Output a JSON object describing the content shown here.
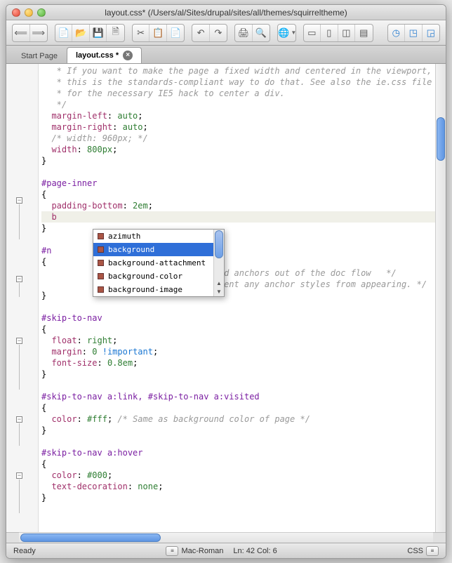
{
  "window": {
    "title": "layout.css* (/Users/al/Sites/drupal/sites/all/themes/squirreltheme)"
  },
  "tabs": {
    "start": "Start Page",
    "active": "layout.css  *"
  },
  "code": {
    "c1": "   * If you want to make the page a fixed width and centered in the viewport,",
    "c2": "   * this is the standards-compliant way to do that. See also the ie.css file",
    "c3": "   * for the necessary IE5 hack to center a div.",
    "c4": "   */",
    "p_ml": "  margin-left",
    "v_auto": "auto",
    "p_mr": "  margin-right",
    "c5": "  /* width: 960px; */",
    "p_w": "  width",
    "v_800": "800px",
    "brace_close": "}",
    "brace_open": "{",
    "sel_pi": "#page-inner",
    "p_pb": "  padding-bottom",
    "v_2em": "2em",
    "cur_b": "  b",
    "sel_n1": "#n",
    "c_named": "/*  the named anchors out of the doc flow   */",
    "c_prevent": "/*  and prevent any anchor styles from appearing. */",
    "sel_stn": "#skip-to-nav",
    "p_fl": "  float",
    "v_right": "right",
    "p_mg": "  margin",
    "v_0": "0",
    "v_imp": "!important",
    "p_fs": "  font-size",
    "v_08em": "0.8em",
    "sel_stn_link": "#skip-to-nav a:link, #skip-to-nav a:visited",
    "p_col": "  color",
    "v_fff": "#fff",
    "c_same": "/* Same as background color of page */",
    "sel_stn_hover": "#skip-to-nav a:hover",
    "v_000": "#000",
    "p_td": "  text-decoration",
    "v_none": "none"
  },
  "autocomplete": {
    "items": [
      "azimuth",
      "background",
      "background-attachment",
      "background-color",
      "background-image"
    ],
    "selected_index": 1
  },
  "status": {
    "ready": "Ready",
    "encoding": "Mac-Roman",
    "position": "Ln: 42 Col: 6",
    "language": "CSS"
  }
}
